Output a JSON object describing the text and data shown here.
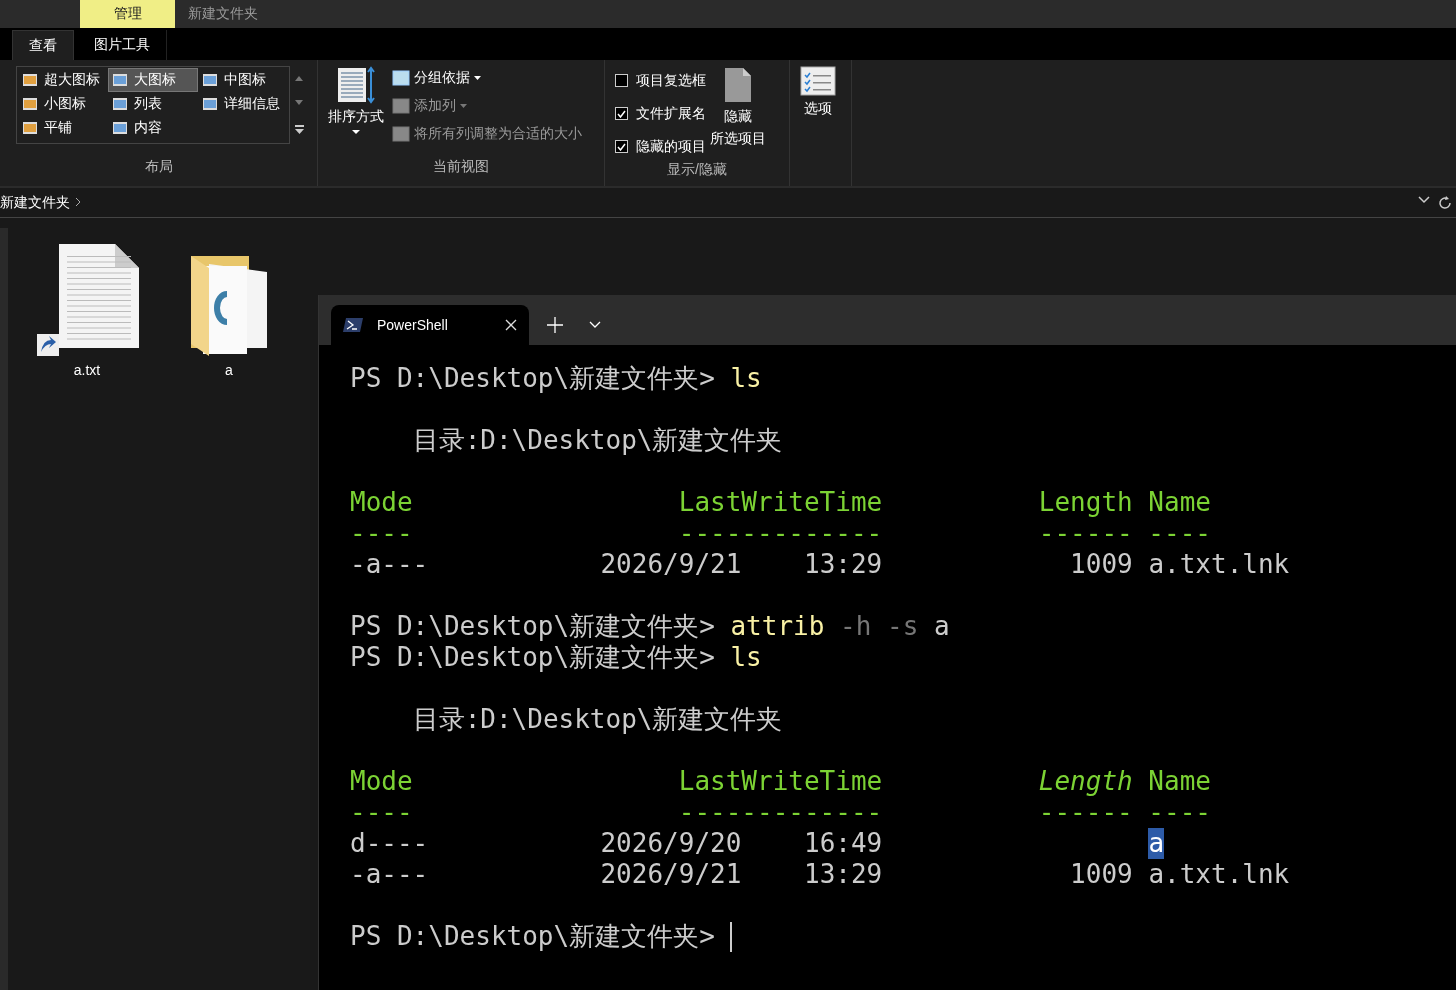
{
  "explorer": {
    "title_tabs": [
      {
        "label": "管理",
        "kind": "context"
      },
      {
        "label": "新建文件夹",
        "kind": "title"
      }
    ],
    "ribbon_tabs": [
      {
        "label": "查看",
        "selected": true
      },
      {
        "label": "图片工具",
        "selected": false
      }
    ],
    "layout_group": {
      "label": "布局",
      "items": [
        {
          "label": "超大图标",
          "selected": false
        },
        {
          "label": "大图标",
          "selected": true
        },
        {
          "label": "中图标",
          "selected": false
        },
        {
          "label": "小图标",
          "selected": false
        },
        {
          "label": "列表",
          "selected": false
        },
        {
          "label": "详细信息",
          "selected": false
        },
        {
          "label": "平铺",
          "selected": false
        },
        {
          "label": "内容",
          "selected": false
        }
      ]
    },
    "view_group": {
      "label": "当前视图",
      "sort_button": "排序方式",
      "commands": [
        {
          "label": "分组依据",
          "disabled": false,
          "dropdown": true
        },
        {
          "label": "添加列",
          "disabled": true,
          "dropdown": true
        },
        {
          "label": "将所有列调整为合适的大小",
          "disabled": true,
          "dropdown": false
        }
      ]
    },
    "show_group": {
      "label": "显示/隐藏",
      "checkboxes": [
        {
          "label": "项目复选框",
          "checked": false
        },
        {
          "label": "文件扩展名",
          "checked": true
        },
        {
          "label": "隐藏的项目",
          "checked": true
        }
      ],
      "hide_button": [
        "隐藏",
        "所选项目"
      ]
    },
    "options_button": "选项",
    "breadcrumb": "新建文件夹",
    "files": [
      {
        "name": "a.txt",
        "kind": "shortcut"
      },
      {
        "name": "a",
        "kind": "folder"
      }
    ]
  },
  "terminal": {
    "tabs": [
      {
        "title": "PowerShell",
        "selected": true
      }
    ],
    "lines": [
      {
        "kind": "line",
        "segments": [
          {
            "text": "PS D:\\Desktop\\新建文件夹> ",
            "kind": "prompt"
          },
          {
            "text": "ls",
            "kind": "command"
          }
        ]
      },
      {
        "kind": "blank"
      },
      {
        "kind": "line",
        "segments": [
          {
            "text": "    目录:D:\\Desktop\\新建文件夹",
            "kind": "text"
          }
        ]
      },
      {
        "kind": "blank"
      },
      {
        "kind": "line",
        "segments": [
          {
            "text": "Mode",
            "kind": "header"
          },
          {
            "text": "                 LastWriteTime",
            "kind": "header"
          },
          {
            "text": "          Length",
            "kind": "header"
          },
          {
            "text": " Name",
            "kind": "header"
          }
        ]
      },
      {
        "kind": "line",
        "segments": [
          {
            "text": "----",
            "kind": "header"
          },
          {
            "text": "                 -------------",
            "kind": "header"
          },
          {
            "text": "          ------",
            "kind": "header"
          },
          {
            "text": " ----",
            "kind": "header"
          }
        ]
      },
      {
        "kind": "line",
        "segments": [
          {
            "text": "-a---",
            "kind": "text"
          },
          {
            "text": "           2026/9/21",
            "kind": "text"
          },
          {
            "text": "    13:29",
            "kind": "text"
          },
          {
            "text": "            1009",
            "kind": "text"
          },
          {
            "text": " a.txt.lnk",
            "kind": "text"
          }
        ]
      },
      {
        "kind": "blank"
      },
      {
        "kind": "line",
        "segments": [
          {
            "text": "PS D:\\Desktop\\新建文件夹> ",
            "kind": "prompt"
          },
          {
            "text": "attrib",
            "kind": "command"
          },
          {
            "text": " -h -s",
            "kind": "param"
          },
          {
            "text": " a",
            "kind": "text"
          }
        ]
      },
      {
        "kind": "line",
        "segments": [
          {
            "text": "PS D:\\Desktop\\新建文件夹> ",
            "kind": "prompt"
          },
          {
            "text": "ls",
            "kind": "command"
          }
        ]
      },
      {
        "kind": "blank"
      },
      {
        "kind": "line",
        "segments": [
          {
            "text": "    目录:D:\\Desktop\\新建文件夹",
            "kind": "text"
          }
        ]
      },
      {
        "kind": "blank"
      },
      {
        "kind": "line",
        "segments": [
          {
            "text": "Mode",
            "kind": "header"
          },
          {
            "text": "                 LastWriteTime",
            "kind": "header"
          },
          {
            "text": "          Length",
            "kind": "header-italic"
          },
          {
            "text": " Name",
            "kind": "header"
          }
        ]
      },
      {
        "kind": "line",
        "segments": [
          {
            "text": "----",
            "kind": "header"
          },
          {
            "text": "                 -------------",
            "kind": "header"
          },
          {
            "text": "          ------",
            "kind": "header"
          },
          {
            "text": " ----",
            "kind": "header"
          }
        ]
      },
      {
        "kind": "line",
        "segments": [
          {
            "text": "d----",
            "kind": "text"
          },
          {
            "text": "           2026/9/20",
            "kind": "text"
          },
          {
            "text": "    16:49",
            "kind": "text"
          },
          {
            "text": "                 a",
            "kind": "selection"
          }
        ]
      },
      {
        "kind": "line",
        "segments": [
          {
            "text": "-a---",
            "kind": "text"
          },
          {
            "text": "           2026/9/21",
            "kind": "text"
          },
          {
            "text": "    13:29",
            "kind": "text"
          },
          {
            "text": "            1009",
            "kind": "text"
          },
          {
            "text": " a.txt.lnk",
            "kind": "text"
          }
        ]
      },
      {
        "kind": "blank"
      },
      {
        "kind": "current",
        "segments": [
          {
            "text": "PS D:\\Desktop\\新建文件夹> ",
            "kind": "prompt"
          }
        ]
      }
    ]
  }
}
